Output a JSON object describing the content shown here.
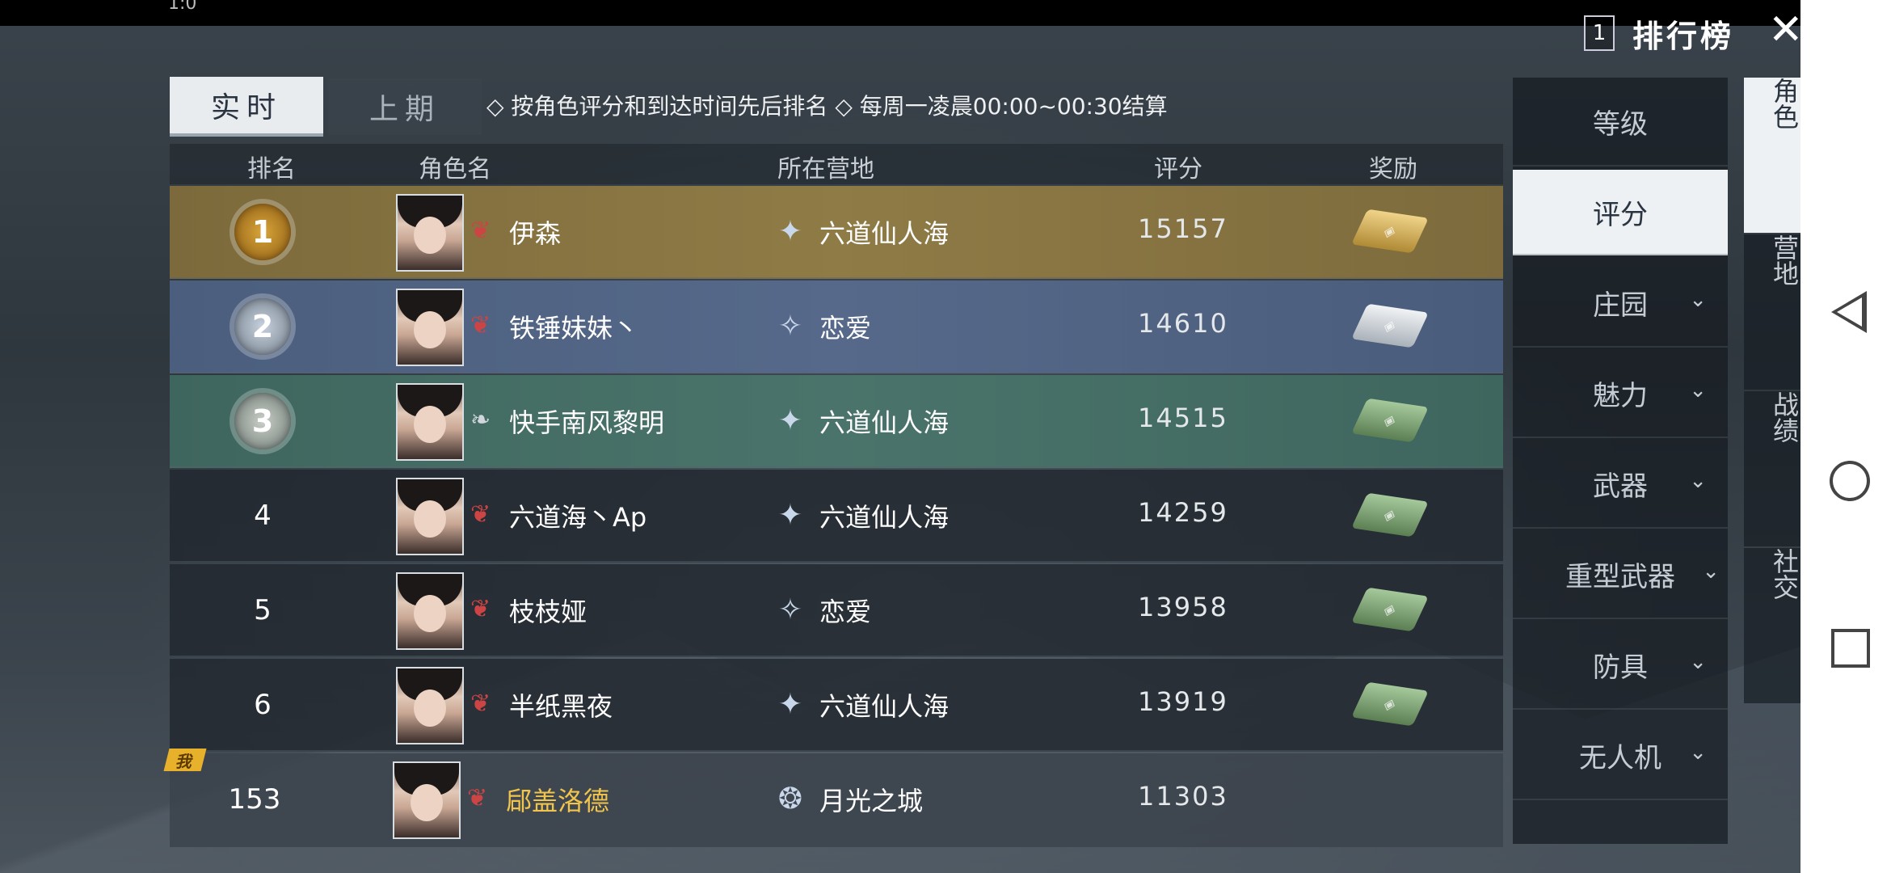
{
  "status_bar": {
    "clock": "1:0"
  },
  "header": {
    "rank_number": "1",
    "title": "排行榜",
    "close": "✕"
  },
  "tabs": [
    {
      "label": "实时",
      "active": true
    },
    {
      "label": "上期",
      "active": false
    }
  ],
  "tip": "◇ 按角色评分和到达时间先后排名 ◇ 每周一凌晨00:00~00:30结算",
  "columns": {
    "rank": "排名",
    "name": "角色名",
    "camp": "所在营地",
    "score": "评分",
    "reward": "奖励"
  },
  "rows": [
    {
      "rank": "1",
      "name": "伊森",
      "camp": "六道仙人海",
      "score": "15157",
      "reward": "gold-crate"
    },
    {
      "rank": "2",
      "name": "铁锤妹妹丶",
      "camp": "恋爱",
      "score": "14610",
      "reward": "silver-crate"
    },
    {
      "rank": "3",
      "name": "快手南风黎明",
      "camp": "六道仙人海",
      "score": "14515",
      "reward": "green-crate"
    },
    {
      "rank": "4",
      "name": "六道海丶Ap",
      "camp": "六道仙人海",
      "score": "14259",
      "reward": "green-crate"
    },
    {
      "rank": "5",
      "name": "枝枝娅",
      "camp": "恋爱",
      "score": "13958",
      "reward": "green-crate"
    },
    {
      "rank": "6",
      "name": "半纸黑夜",
      "camp": "六道仙人海",
      "score": "13919",
      "reward": "green-crate"
    }
  ],
  "me": {
    "tag": "我",
    "rank": "153",
    "name": "郈盖洛德",
    "camp": "月光之城",
    "score": "11303"
  },
  "categories": [
    {
      "label": "等级",
      "has_dropdown": false,
      "active": false
    },
    {
      "label": "评分",
      "has_dropdown": false,
      "active": true
    },
    {
      "label": "庄园",
      "has_dropdown": true,
      "active": false
    },
    {
      "label": "魅力",
      "has_dropdown": true,
      "active": false
    },
    {
      "label": "武器",
      "has_dropdown": true,
      "active": false
    },
    {
      "label": "重型武器",
      "has_dropdown": true,
      "active": false
    },
    {
      "label": "防具",
      "has_dropdown": true,
      "active": false
    },
    {
      "label": "无人机",
      "has_dropdown": true,
      "active": false
    }
  ],
  "side_tabs": [
    {
      "label": "角色",
      "active": true
    },
    {
      "label": "营地",
      "active": false
    },
    {
      "label": "战绩",
      "active": false
    },
    {
      "label": "社交",
      "active": false
    }
  ],
  "chevron": "⌄",
  "colors": {
    "gold_row": "#8f7b45",
    "silver_row": "#56698a",
    "jade_row": "#4a746b",
    "self_name": "#f1c54b"
  }
}
